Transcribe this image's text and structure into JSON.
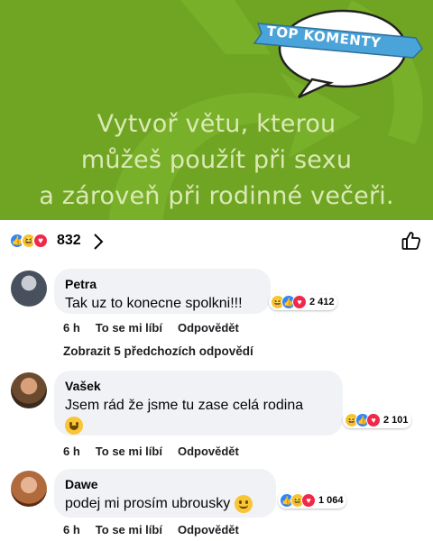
{
  "post": {
    "lines": [
      "Vytvoř větu, kterou",
      "můžeš použít při sexu",
      "a zároveň při rodinné večeři."
    ],
    "badge": "TOP KOMENTY",
    "colors": {
      "green": "#6fa523",
      "text": "#dbe9b4",
      "ribbon": "#4aa3d9"
    }
  },
  "reactions": {
    "icons": [
      "like-icon",
      "haha-icon",
      "love-icon"
    ],
    "count": "832"
  },
  "comments": [
    {
      "author": "Petra",
      "text": "Tak uz to konecne spolkni!!!",
      "reaction_count": "2 412",
      "time": "6 h",
      "like": "To se mi líbí",
      "reply": "Odpovědět"
    },
    {
      "author": "Vašek",
      "text": "Jsem rád že jsme tu zase celá rodina",
      "reaction_count": "2 101",
      "time": "6 h",
      "like": "To se mi líbí",
      "reply": "Odpovědět"
    },
    {
      "author": "Dawe",
      "text": "podej mi prosím ubrousky",
      "reaction_count": "1 064",
      "time": "6 h",
      "like": "To se mi líbí",
      "reply": "Odpovědět"
    }
  ],
  "more_replies": "Zobrazit 5 předchozích odpovědí"
}
